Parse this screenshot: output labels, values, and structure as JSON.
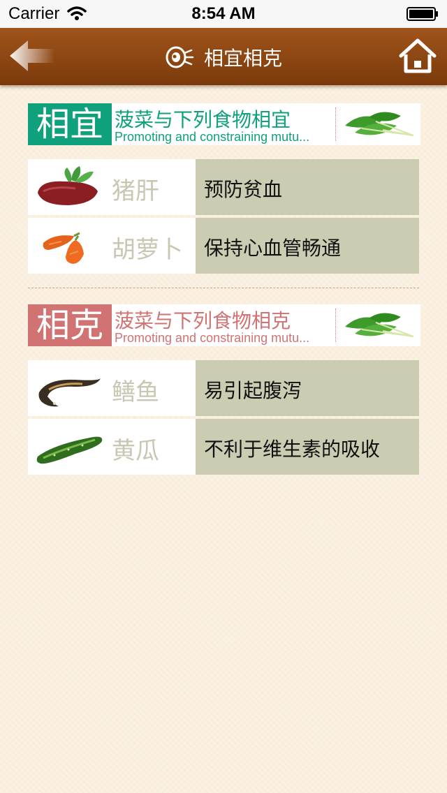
{
  "status_bar": {
    "carrier": "Carrier",
    "time": "8:54 AM"
  },
  "nav": {
    "title": "相宜相克",
    "back_icon": "back-arrow-icon",
    "home_icon": "home-icon",
    "title_icon": "meat-icon",
    "bar_color": "#8b4612"
  },
  "sections": {
    "compatible": {
      "badge": "相宜",
      "title": "菠菜与下列食物相宜",
      "subtitle": "Promoting and constraining mutu...",
      "color": "#0fa17c",
      "items": [
        {
          "name": "猪肝",
          "effect": "预防贫血",
          "image": "pork-liver"
        },
        {
          "name": "胡萝卜",
          "effect": "保持心血管畅通",
          "image": "carrot"
        }
      ]
    },
    "incompatible": {
      "badge": "相克",
      "title": "菠菜与下列食物相克",
      "subtitle": "Promoting and constraining mutu...",
      "color": "#d17273",
      "items": [
        {
          "name": "鳝鱼",
          "effect": "易引起腹泻",
          "image": "eel"
        },
        {
          "name": "黄瓜",
          "effect": "不利于维生素的吸收",
          "image": "cucumber"
        }
      ]
    }
  }
}
